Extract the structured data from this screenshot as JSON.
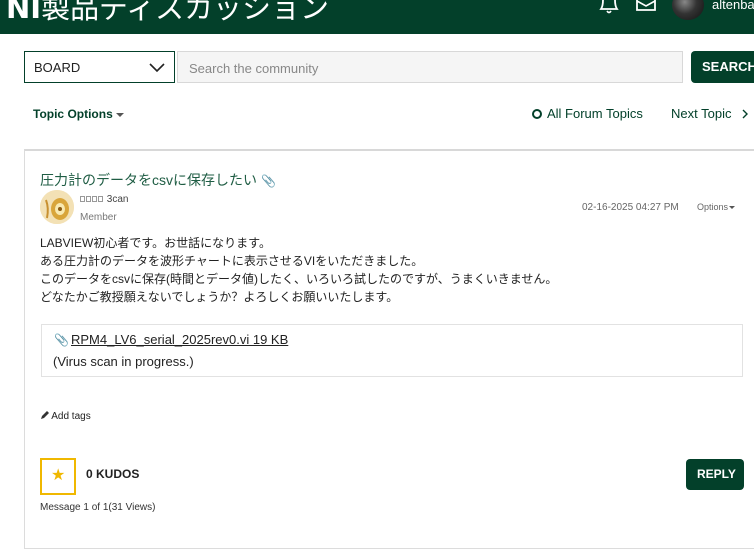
{
  "header": {
    "title_bold": "NI",
    "title_rest": "製品ディスカッション",
    "username": "altenbach"
  },
  "search": {
    "board_label": "BOARD",
    "placeholder": "Search the community",
    "button_label": "SEARCH"
  },
  "nav": {
    "topic_options": "Topic Options",
    "all_forum_topics": "All Forum Topics",
    "next_topic": "Next Topic"
  },
  "post": {
    "title": "圧力計のデータをcsvに保存したい",
    "author": "3can",
    "rank": "Member",
    "date": "02-16-2025 04:27 PM",
    "options": "Options",
    "body": [
      "LABVIEW初心者です。お世話になります。",
      "ある圧力計のデータを波形チャートに表示させるVIをいただきました。",
      "このデータをcsvに保存(時間とデータ値)したく、いろいろ試したのですが、うまくいきません。",
      "どなたかご教授願えないでしょうか？よろしくお願いいたします。"
    ],
    "attachment": {
      "filename": "RPM4_LV6_serial_2025rev0.vi 19 KB",
      "status": "(Virus scan in progress.)"
    },
    "add_tags": "Add tags",
    "kudos": "0 KUDOS",
    "reply": "REPLY",
    "message_count": "Message 1 of 1(31 Views)"
  },
  "colors": {
    "brand_green": "#03402a",
    "kudo_yellow": "#f0b800"
  }
}
